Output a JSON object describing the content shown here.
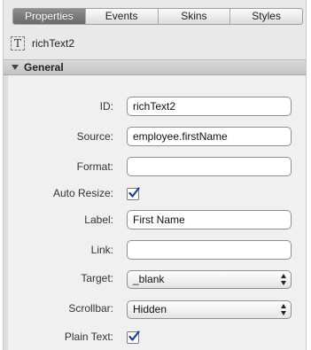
{
  "tabs": [
    {
      "label": "Properties",
      "active": true
    },
    {
      "label": "Events",
      "active": false
    },
    {
      "label": "Skins",
      "active": false
    },
    {
      "label": "Styles",
      "active": false
    }
  ],
  "component": {
    "icon": "text-component-icon",
    "icon_glyph": "T",
    "name": "richText2"
  },
  "section": {
    "title": "General",
    "expanded": true
  },
  "fields": {
    "id": {
      "label": "ID:",
      "value": "richText2"
    },
    "source": {
      "label": "Source:",
      "value": "employee.firstName"
    },
    "format": {
      "label": "Format:",
      "value": ""
    },
    "auto_resize": {
      "label": "Auto Resize:",
      "checked": true
    },
    "label": {
      "label": "Label:",
      "value": "First Name"
    },
    "link": {
      "label": "Link:",
      "value": ""
    },
    "target": {
      "label": "Target:",
      "value": "_blank"
    },
    "scrollbar": {
      "label": "Scrollbar:",
      "value": "Hidden"
    },
    "plain_text": {
      "label": "Plain Text:",
      "checked": true
    }
  },
  "colors": {
    "checkmark": "#1b3f9c",
    "active_tab": "#7a7a7a"
  }
}
